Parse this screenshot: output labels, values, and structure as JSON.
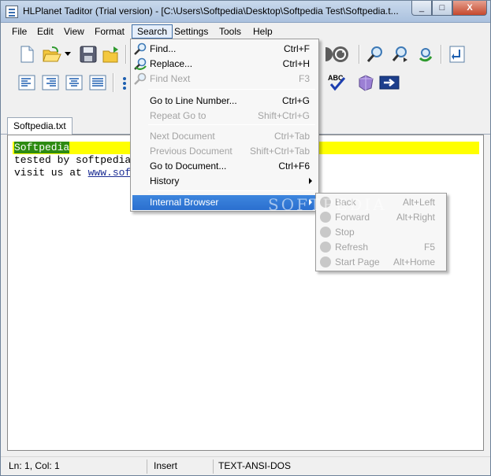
{
  "window": {
    "title": "HLPlanet Taditor (Trial version) - [C:\\Users\\Softpedia\\Desktop\\Softpedia Test\\Softpedia.t...",
    "minimize_glyph": "_",
    "maximize_glyph": "□",
    "close_glyph": "X"
  },
  "menubar": {
    "file": "File",
    "edit": "Edit",
    "view": "View",
    "format": "Format",
    "search": "Search",
    "settings": "Settings",
    "tools": "Tools",
    "help": "Help"
  },
  "toolbar_spell_label": "ABC",
  "tab": {
    "label": "Softpedia.txt"
  },
  "editor": {
    "line1_selected": "Softpedia",
    "line2": "tested by softpedia",
    "line3_prefix": "visit us at ",
    "line3_link": "www.sof"
  },
  "search_menu": {
    "items": [
      {
        "label": "Find...",
        "shortcut": "Ctrl+F",
        "enabled": true,
        "icon": "find-icon"
      },
      {
        "label": "Replace...",
        "shortcut": "Ctrl+H",
        "enabled": true,
        "icon": "replace-icon"
      },
      {
        "label": "Find Next",
        "shortcut": "F3",
        "enabled": false,
        "icon": "find-next-icon"
      },
      {
        "label": "Go to Line Number...",
        "shortcut": "Ctrl+G",
        "enabled": true
      },
      {
        "label": "Repeat Go to",
        "shortcut": "Shift+Ctrl+G",
        "enabled": false
      },
      {
        "label": "Next Document",
        "shortcut": "Ctrl+Tab",
        "enabled": false
      },
      {
        "label": "Previous Document",
        "shortcut": "Shift+Ctrl+Tab",
        "enabled": false
      },
      {
        "label": "Go to Document...",
        "shortcut": "Ctrl+F6",
        "enabled": true
      },
      {
        "label": "History",
        "shortcut": "",
        "enabled": true,
        "submenu": true
      },
      {
        "label": "Internal Browser",
        "shortcut": "",
        "enabled": true,
        "submenu": true,
        "highlighted": true
      }
    ]
  },
  "browser_submenu": {
    "items": [
      {
        "label": "Back",
        "shortcut": "Alt+Left",
        "enabled": false
      },
      {
        "label": "Forward",
        "shortcut": "Alt+Right",
        "enabled": false
      },
      {
        "label": "Stop",
        "shortcut": "",
        "enabled": false
      },
      {
        "label": "Refresh",
        "shortcut": "F5",
        "enabled": false
      },
      {
        "label": "Start Page",
        "shortcut": "Alt+Home",
        "enabled": false
      }
    ]
  },
  "statusbar": {
    "position": "Ln: 1, Col: 1",
    "mode": "Insert",
    "encoding": "TEXT-ANSI-DOS"
  },
  "watermark": "SOFTPEDIA",
  "colors": {
    "line_highlight": "#ffff00",
    "selection": "#2e8b12",
    "menu_highlight": "#2b6fcf"
  }
}
